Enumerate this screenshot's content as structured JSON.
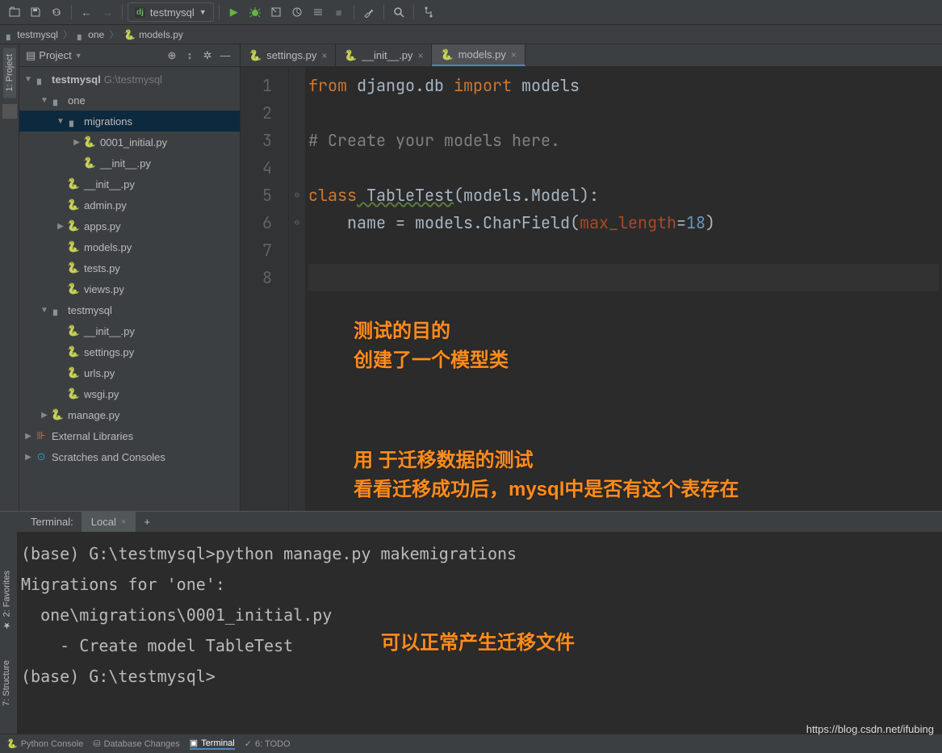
{
  "toolbar": {
    "run_config_label": "testmysql"
  },
  "breadcrumb": {
    "items": [
      "testmysql",
      "one",
      "models.py"
    ]
  },
  "project_panel": {
    "title": "Project",
    "tree": {
      "root": "testmysql",
      "root_path": "G:\\testmysql",
      "one": "one",
      "migrations": "migrations",
      "mig_0001": "0001_initial.py",
      "mig_init": "__init__.py",
      "one_init": "__init__.py",
      "admin": "admin.py",
      "apps": "apps.py",
      "models": "models.py",
      "tests": "tests.py",
      "views": "views.py",
      "testmysql_pkg": "testmysql",
      "pkg_init": "__init__.py",
      "settings": "settings.py",
      "urls": "urls.py",
      "wsgi": "wsgi.py",
      "manage": "manage.py",
      "ext_lib": "External Libraries",
      "scratches": "Scratches and Consoles"
    }
  },
  "editor": {
    "tabs": [
      {
        "label": "settings.py",
        "active": false
      },
      {
        "label": "__init__.py",
        "active": false
      },
      {
        "label": "models.py",
        "active": true
      }
    ],
    "line_numbers": [
      "1",
      "2",
      "3",
      "4",
      "5",
      "6",
      "7",
      "8"
    ],
    "code": {
      "l1_from": "from",
      "l1_pkg": " django.db ",
      "l1_import": "import",
      "l1_mod": " models",
      "l3_cmt": "# Create your models here.",
      "l5_class": "class",
      "l5_name": " TableTest",
      "l5_args": "(models.Model):",
      "l6_indent": "    name = models.CharField(",
      "l6_param": "max_length",
      "l6_eq": "=",
      "l6_num": "18",
      "l6_close": ")"
    },
    "annotations": {
      "a1": "测试的目的\n创建了一个模型类",
      "a2": "用 于迁移数据的测试\n看看迁移成功后，mysql中是否有这个表存在"
    }
  },
  "terminal": {
    "panel_label": "Terminal:",
    "tab_label": "Local",
    "lines": [
      "(base) G:\\testmysql>python manage.py makemigrations",
      "Migrations for 'one':",
      "  one\\migrations\\0001_initial.py",
      "    - Create model TableTest",
      "",
      "(base) G:\\testmysql>"
    ],
    "annotation": "可以正常产生迁移文件"
  },
  "bottom_bar": {
    "python_console": "Python Console",
    "db_changes": "Database Changes",
    "terminal": "Terminal",
    "todo": "6: TODO"
  },
  "left_tabs": {
    "project": "1: Project",
    "favorites": "2: Favorites",
    "structure": "7: Structure"
  },
  "watermark": "https://blog.csdn.net/ifubing"
}
